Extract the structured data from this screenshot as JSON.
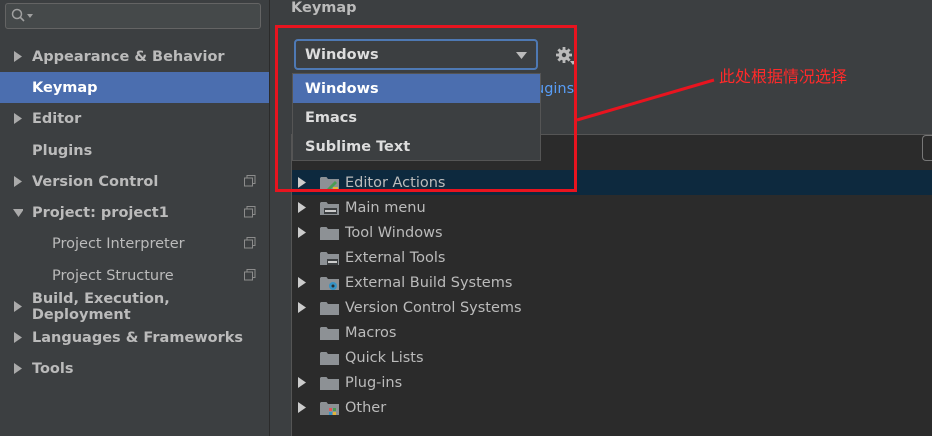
{
  "sidebar": {
    "search": {
      "value": "",
      "placeholder": ""
    },
    "items": [
      {
        "label": "Appearance & Behavior"
      },
      {
        "label": "Keymap"
      },
      {
        "label": "Editor"
      },
      {
        "label": "Plugins"
      },
      {
        "label": "Version Control"
      },
      {
        "label": "Project: project1"
      },
      {
        "label": "Project Interpreter"
      },
      {
        "label": "Project Structure"
      },
      {
        "label": "Build, Execution, Deployment"
      },
      {
        "label": "Languages & Frameworks"
      },
      {
        "label": "Tools"
      }
    ]
  },
  "main": {
    "title": "Keymap",
    "keymap_select": {
      "value": "Windows"
    },
    "link_partial": "ugins",
    "dropdown_options": [
      {
        "label": "Windows"
      },
      {
        "label": "Emacs"
      },
      {
        "label": "Sublime Text"
      }
    ],
    "tree": [
      {
        "label": "Editor Actions",
        "icon": "editor-actions-folder-icon"
      },
      {
        "label": "Main menu",
        "icon": "main-menu-folder-icon"
      },
      {
        "label": "Tool Windows",
        "icon": "folder-icon"
      },
      {
        "label": "External Tools",
        "icon": "external-tools-folder-icon"
      },
      {
        "label": "External Build Systems",
        "icon": "build-systems-folder-icon"
      },
      {
        "label": "Version Control Systems",
        "icon": "folder-icon"
      },
      {
        "label": "Macros",
        "icon": "folder-icon"
      },
      {
        "label": "Quick Lists",
        "icon": "folder-icon"
      },
      {
        "label": "Plug-ins",
        "icon": "folder-icon"
      },
      {
        "label": "Other",
        "icon": "other-folder-icon"
      }
    ]
  },
  "annotation": {
    "text": "此处根据情况选择"
  },
  "colors": {
    "selection": "#4b6eaf",
    "tree_selection": "#0d293e",
    "annotation_red": "#e8141f",
    "link_blue": "#589df6"
  }
}
